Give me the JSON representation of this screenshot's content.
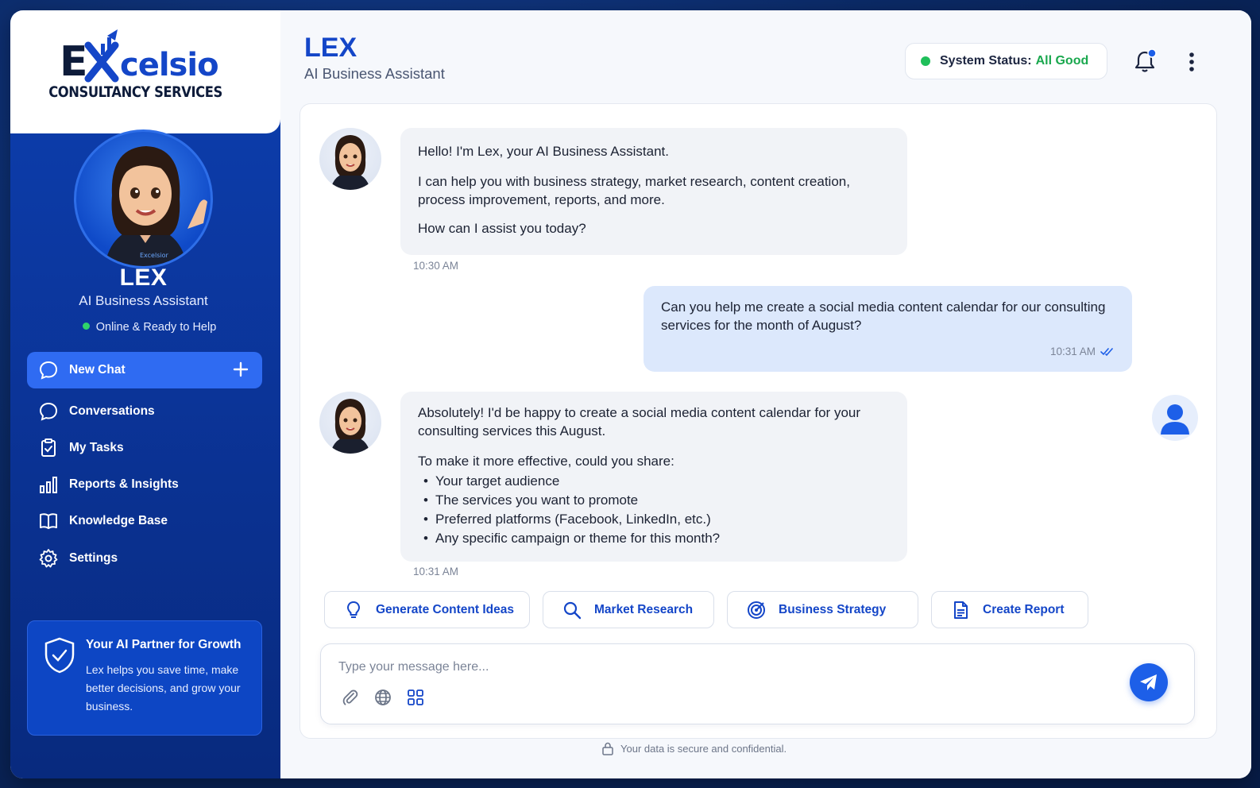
{
  "brand": {
    "logo_text": "Excelsior",
    "logo_sub": "CONSULTANCY SERVICES"
  },
  "agent": {
    "name": "LEX",
    "role": "AI Business Assistant",
    "status": "Online & Ready to Help"
  },
  "sidebar": {
    "new_chat": "New Chat",
    "items": [
      {
        "label": "Conversations",
        "icon": "chat-bubble-icon"
      },
      {
        "label": "My Tasks",
        "icon": "clipboard-check-icon"
      },
      {
        "label": "Reports & Insights",
        "icon": "bar-chart-icon"
      },
      {
        "label": "Knowledge Base",
        "icon": "book-icon"
      },
      {
        "label": "Settings",
        "icon": "gear-icon"
      }
    ],
    "promo": {
      "title": "Your AI Partner for Growth",
      "body": "Lex helps you save time, make better decisions, and grow your business."
    }
  },
  "header": {
    "title": "LEX",
    "subtitle": "AI Business Assistant",
    "status_label": "System Status:",
    "status_value": "All Good"
  },
  "messages": [
    {
      "sender": "bot",
      "paragraphs": [
        "Hello! I'm Lex, your AI Business Assistant.",
        "I can help you with business strategy, market research, content creation, process improvement, reports, and more.",
        "How can I assist you today?"
      ],
      "time": "10:30 AM"
    },
    {
      "sender": "user",
      "text": "Can you help me create a social media content calendar for our consulting services for the month of August?",
      "time": "10:31 AM"
    },
    {
      "sender": "bot",
      "paragraphs": [
        "Absolutely! I'd be happy to create a social media content calendar for your consulting services this August.",
        "To make it more effective, could you share:"
      ],
      "bullets": [
        "Your target audience",
        "The services you want to promote",
        "Preferred platforms (Facebook, LinkedIn, etc.)",
        "Any specific campaign or theme for this month?"
      ],
      "time": "10:31 AM"
    }
  ],
  "quick_actions": [
    {
      "label": "Generate Content Ideas",
      "icon": "lightbulb-icon"
    },
    {
      "label": "Market Research",
      "icon": "search-icon"
    },
    {
      "label": "Business Strategy",
      "icon": "target-icon"
    },
    {
      "label": "Create Report",
      "icon": "document-icon"
    }
  ],
  "composer": {
    "placeholder": "Type your message here..."
  },
  "footer": {
    "secure_note": "Your data is secure and confidential."
  },
  "colors": {
    "primary": "#1446c8",
    "sidebar": "#0b3498",
    "accent_button": "#2f6bf2",
    "status_green": "#1aa84e",
    "user_bubble": "#dce8fc",
    "bot_bubble": "#f1f3f7"
  }
}
